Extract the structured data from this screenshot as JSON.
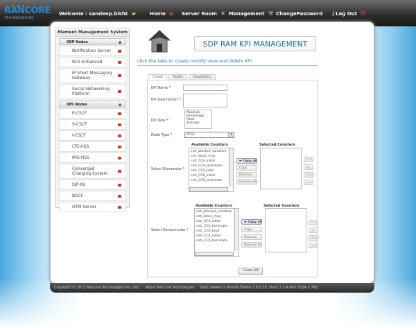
{
  "header": {
    "logo_text": "RANCORE",
    "logo_subtext": "TECHNOLOGIES",
    "welcome": "Welcome : sandeep.bisht",
    "nav": [
      {
        "label": "Home",
        "icon": "home-icon"
      },
      {
        "label": "Server Room",
        "icon": "tools-icon"
      },
      {
        "label": "Management",
        "icon": "wrench-icon"
      },
      {
        "label": "ChangePassword",
        "icon": "key-icon"
      },
      {
        "label": "Log Out",
        "icon": "power-icon"
      }
    ]
  },
  "sidebar": {
    "title": "Element Management System",
    "groups": [
      {
        "label": "SDP Nodes",
        "items": [
          {
            "label": "Notification Server"
          },
          {
            "label": "RCS Enhanced"
          },
          {
            "label": "IP-Short Messaging Gateway"
          },
          {
            "label": "Social Networking Platform"
          }
        ]
      },
      {
        "label": "IMS Nodes",
        "items": [
          {
            "label": "P-CSCF"
          },
          {
            "label": "S-CSCF"
          },
          {
            "label": "I-CSCF"
          },
          {
            "label": "LTE-HSS"
          },
          {
            "label": "IMS-HSS"
          },
          {
            "label": "Converged Charging System"
          },
          {
            "label": "SIP-AS"
          },
          {
            "label": "BGCF"
          },
          {
            "label": "OTM Server"
          }
        ]
      }
    ]
  },
  "main": {
    "title": "SDP RAM KPI MANAGEMENT",
    "subtitle": "click the tabs to create modify view and delete KPI",
    "tabs": [
      "Create",
      "Modify",
      "View/Delete"
    ],
    "active_tab": "Create",
    "form": {
      "kpi_name_label": "KPI Name",
      "kpi_name_value": "",
      "kpi_description_label": "KPI Description",
      "kpi_description_value": "",
      "kpi_type_label": "KPI Type",
      "kpi_type_options": [
        "Absolute",
        "Percentage",
        "Ratio",
        "Average"
      ],
      "node_type_label": "Node Type",
      "node_type_value": "RCSE",
      "numerator_label": "Select Numerator",
      "denominator_label": "Select Denominator",
      "available_counters_label": "Available Counters",
      "selected_counters_label": "Selected Counters",
      "counters": [
        "cntr_blocked_condition",
        "cntr_block_msg",
        "cntr_CCA_initial",
        "cntr_CCA_terminate",
        "cntr_CCA_total",
        "cntr_CCR_initial",
        "cntr_CCR_terminate"
      ],
      "copy_all_label": "Copy all",
      "copy_label": "Copy",
      "remove_label": "Remove",
      "remove_all_label": "Remove All",
      "first_label": "First",
      "up_label": "Up",
      "down_label": "Down",
      "last_label": "Last",
      "create_button": "Create KPI"
    }
  },
  "footer": {
    "copyright": "Copyright © 2012 Rancore Technologies Pvt. Ltd.",
    "about": "About Rancore Technologies",
    "browser_note": "Best viewed in Mozilla Firefox 2.0.0.16, Flock 1.2.4 with 1024 X 768"
  },
  "colors": {
    "accent_blue": "#1b6aa8",
    "header_dark": "#2b2b2b",
    "delete_red": "#d9342b"
  }
}
